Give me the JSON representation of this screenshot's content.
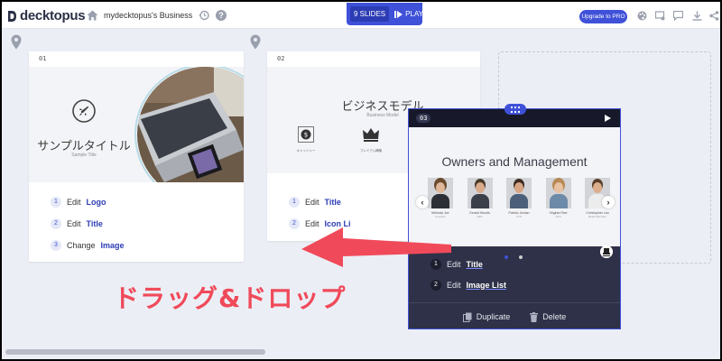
{
  "app": {
    "logo_text": "decktopus",
    "doc_title": "mydecktopus's Business P",
    "help": "?"
  },
  "toolbar": {
    "slides_label": "9 SLIDES",
    "play_label": "PLAY",
    "upgrade_label": "Upgrade to PRO"
  },
  "slide1": {
    "num": "01",
    "title": "サンプルタイトル",
    "subtitle": "Sample Title",
    "edits": [
      {
        "n": "1",
        "verb": "Edit",
        "target": "Logo"
      },
      {
        "n": "2",
        "verb": "Edit",
        "target": "Title"
      },
      {
        "n": "3",
        "verb": "Change",
        "target": "Image"
      }
    ]
  },
  "slide2": {
    "num": "02",
    "title": "ビジネスモデル",
    "subtitle": "Business Model",
    "icons": [
      {
        "label": "キャッシャー"
      },
      {
        "label": "プレミアム構築"
      }
    ],
    "edits": [
      {
        "n": "1",
        "verb": "Edit",
        "target": "Title"
      },
      {
        "n": "2",
        "verb": "Edit",
        "target": "Icon Li"
      }
    ]
  },
  "slide3": {
    "num": "03",
    "title": "Owners and Management",
    "people": [
      {
        "name": "Melinda Joe",
        "role": "Founder",
        "hair": "#6b4a2e",
        "shirt": "#2d2f36"
      },
      {
        "name": "Gerald Woods",
        "role": "CEO",
        "hair": "#4a3a2c",
        "shirt": "#3b3f4a"
      },
      {
        "name": "Patrick Jordan",
        "role": "CTO",
        "hair": "#3d2c22",
        "shirt": "#4b5f7a"
      },
      {
        "name": "Virginia Rice",
        "role": "CFO",
        "hair": "#b88a55",
        "shirt": "#6d8aa8"
      },
      {
        "name": "Christopher Lan",
        "role": "Board Member",
        "hair": "#5a3f2a",
        "shirt": "#ececec"
      }
    ],
    "edits": [
      {
        "n": "1",
        "verb": "Edit",
        "target": "Title"
      },
      {
        "n": "2",
        "verb": "Edit",
        "target": "Image List"
      }
    ],
    "duplicate_label": "Duplicate",
    "delete_label": "Delete"
  },
  "annotation": {
    "text": "ドラッグ&ドロップ",
    "color": "#f04a5a"
  },
  "colors": {
    "accent": "#3f51d8",
    "dark_card": "#2e3147",
    "canvas": "#eceef5"
  }
}
